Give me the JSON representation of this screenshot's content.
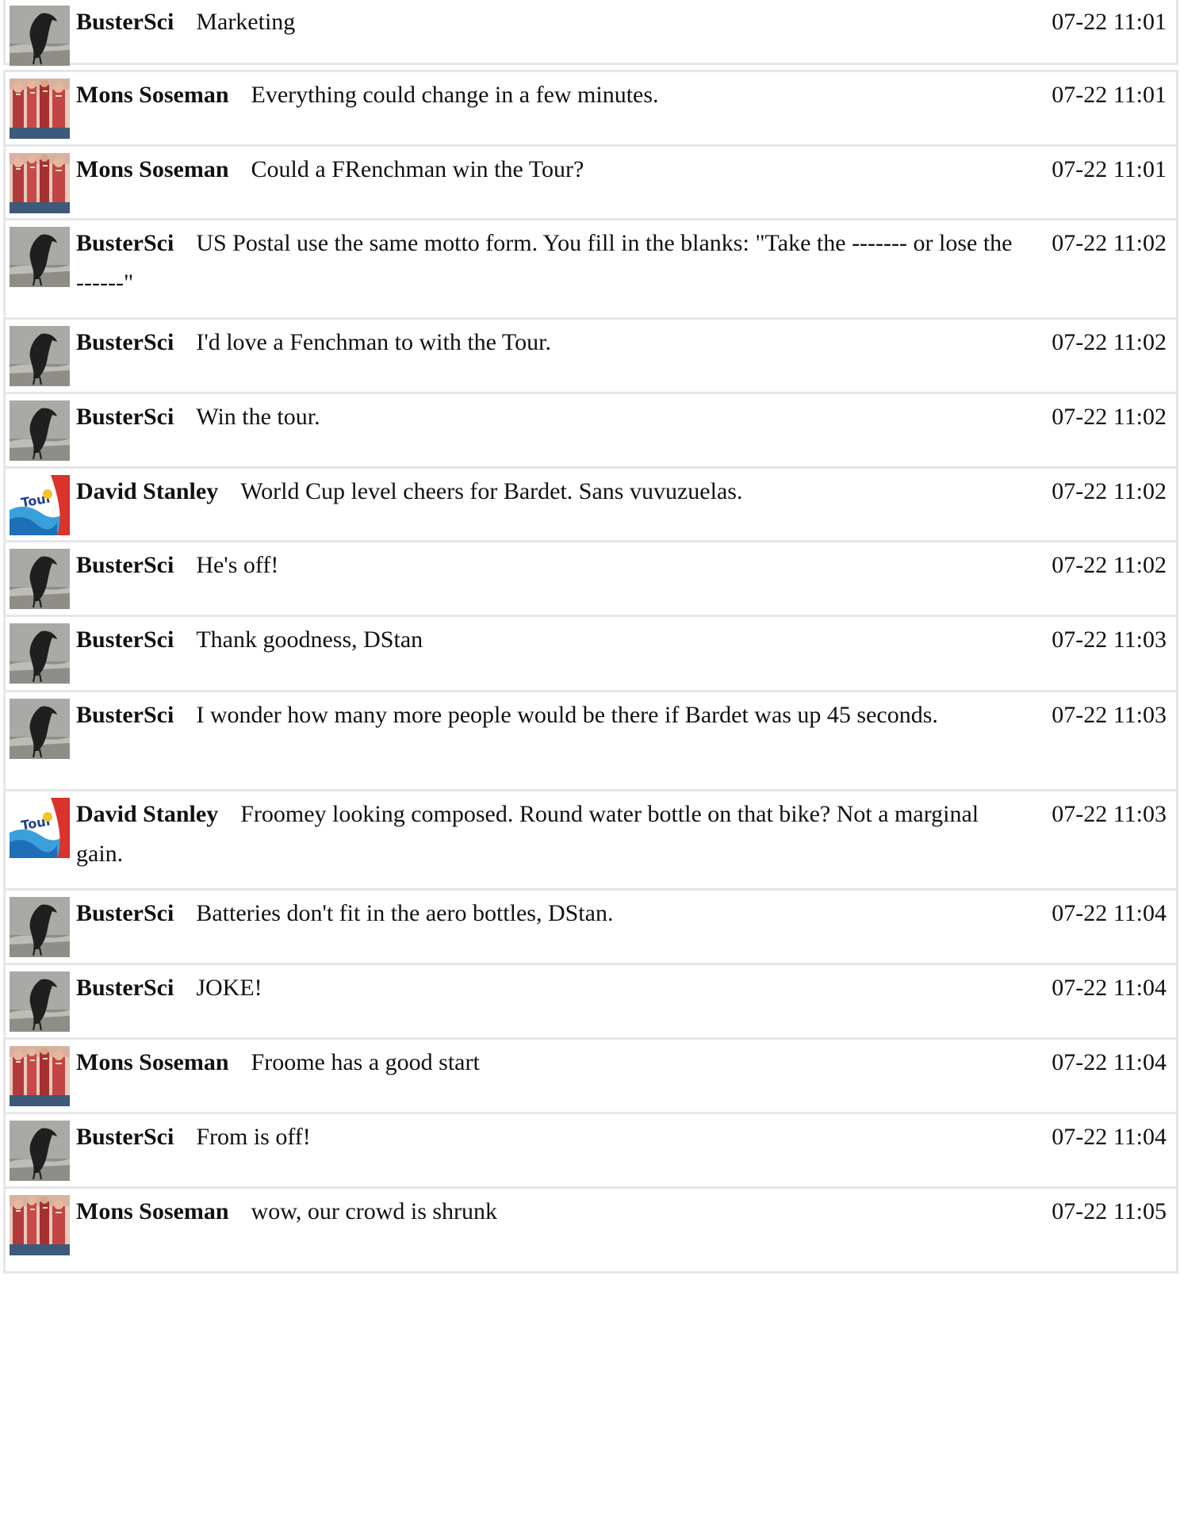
{
  "messages": [
    {
      "author": "BusterSci",
      "avatar": "crow-avatar",
      "text": "Marketing",
      "time": "07-22 11:01"
    },
    {
      "author": "Mons Soseman",
      "avatar": "crowd-avatar",
      "text": "Everything could change in a few minutes.",
      "time": "07-22 11:01"
    },
    {
      "author": "Mons Soseman",
      "avatar": "crowd-avatar",
      "text": "Could a FRenchman win the Tour?",
      "time": "07-22 11:01"
    },
    {
      "author": "BusterSci",
      "avatar": "crow-avatar",
      "text": "US Postal use the same motto form. You fill in the blanks: \"Take the ------- or lose the ------\"",
      "time": "07-22 11:02"
    },
    {
      "author": "BusterSci",
      "avatar": "crow-avatar",
      "text": "I'd love a Fenchman to with the Tour.",
      "time": "07-22 11:02"
    },
    {
      "author": "BusterSci",
      "avatar": "crow-avatar",
      "text": "Win the tour.",
      "time": "07-22 11:02"
    },
    {
      "author": "David Stanley",
      "avatar": "tour-de-france-avatar",
      "text": "World Cup level cheers for Bardet. Sans vuvuzuelas.",
      "time": "07-22 11:02"
    },
    {
      "author": "BusterSci",
      "avatar": "crow-avatar",
      "text": "He's off!",
      "time": "07-22 11:02"
    },
    {
      "author": "BusterSci",
      "avatar": "crow-avatar",
      "text": "Thank goodness, DStan",
      "time": "07-22 11:03"
    },
    {
      "author": "BusterSci",
      "avatar": "crow-avatar",
      "text": "I wonder how many more people would be there if Bardet was up 45 seconds.",
      "time": "07-22 11:03"
    },
    {
      "author": "David Stanley",
      "avatar": "tour-de-france-avatar",
      "text": "Froomey looking composed. Round water bottle on that bike? Not a marginal gain.",
      "time": "07-22 11:03"
    },
    {
      "author": "BusterSci",
      "avatar": "crow-avatar",
      "text": "Batteries don't fit in the aero bottles, DStan.",
      "time": "07-22 11:04"
    },
    {
      "author": "BusterSci",
      "avatar": "crow-avatar",
      "text": "JOKE!",
      "time": "07-22 11:04"
    },
    {
      "author": "Mons Soseman",
      "avatar": "crowd-avatar",
      "text": "Froome has a good start",
      "time": "07-22 11:04"
    },
    {
      "author": "BusterSci",
      "avatar": "crow-avatar",
      "text": "From is off!",
      "time": "07-22 11:04"
    },
    {
      "author": "Mons Soseman",
      "avatar": "crowd-avatar",
      "text": "wow, our crowd is shrunk",
      "time": "07-22 11:05"
    }
  ]
}
